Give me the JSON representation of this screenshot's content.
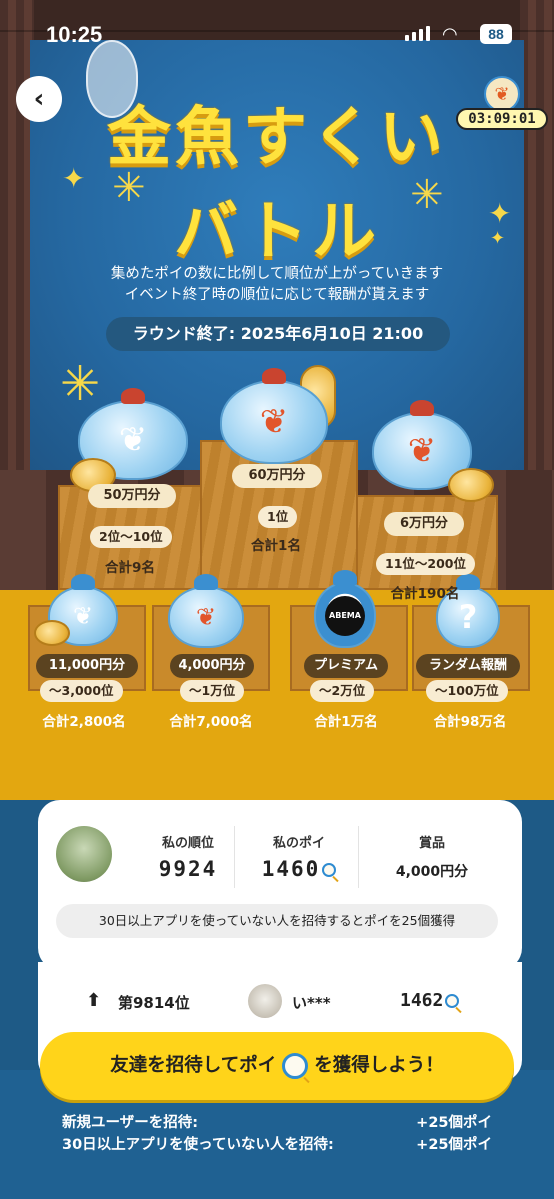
{
  "status_bar": {
    "time": "10:25",
    "battery": "88"
  },
  "header": {
    "timer": "03:09:01"
  },
  "title": {
    "line1": "金魚すくい",
    "line2": "バトル"
  },
  "description": [
    "集めたポイの数に比例して順位が上がっていきます",
    "イベント終了時の順位に応じて報酬が貰えます"
  ],
  "round_end": "ラウンド終了: 2025年6月10日 21:00",
  "prizes_top": [
    {
      "amount": "60万円分",
      "rank": "1位",
      "count": "合計1名"
    },
    {
      "amount": "50万円分",
      "rank": "2位〜10位",
      "count": "合計9名"
    },
    {
      "amount": "6万円分",
      "rank": "11位〜200位",
      "count": "合計190名"
    }
  ],
  "prizes_lower": [
    {
      "amount": "11,000円分",
      "rank": "〜3,000位",
      "count": "合計2,800名"
    },
    {
      "amount": "4,000円分",
      "rank": "〜1万位",
      "count": "合計7,000名"
    },
    {
      "amount": "プレミアム",
      "rank": "〜2万位",
      "count": "合計1万名",
      "badge": "ABEMA"
    },
    {
      "amount": "ランダム報酬",
      "rank": "〜100万位",
      "count": "合計98万名",
      "badge": "?"
    }
  ],
  "my_stats": {
    "rank_label": "私の順位",
    "rank_value": "9924",
    "poi_label": "私のポイ",
    "poi_value": "1460",
    "prize_label": "賞品",
    "prize_value": "4,000円分"
  },
  "invite_hint": "30日以上アプリを使っていない人を招待するとポイを25個獲得",
  "rival": {
    "position": "第9814位",
    "name": "い***",
    "score": "1462"
  },
  "cta": {
    "before": "友達を招待してポイ",
    "after": "を獲得しよう！"
  },
  "rewards": [
    {
      "label": "新規ユーザーを招待:",
      "value": "+25個ポイ"
    },
    {
      "label": "30日以上アプリを使っていない人を招待:",
      "value": "+25個ポイ"
    }
  ],
  "colors": {
    "accent_yellow": "#ffd41a",
    "sea_blue": "#1f6192",
    "title_yellow": "#ffe23d"
  },
  "icons": [
    "back-arrow-icon",
    "goldfish-icon",
    "poi-icon",
    "arrow-up-icon",
    "signal-icon",
    "wifi-icon",
    "battery-icon"
  ]
}
